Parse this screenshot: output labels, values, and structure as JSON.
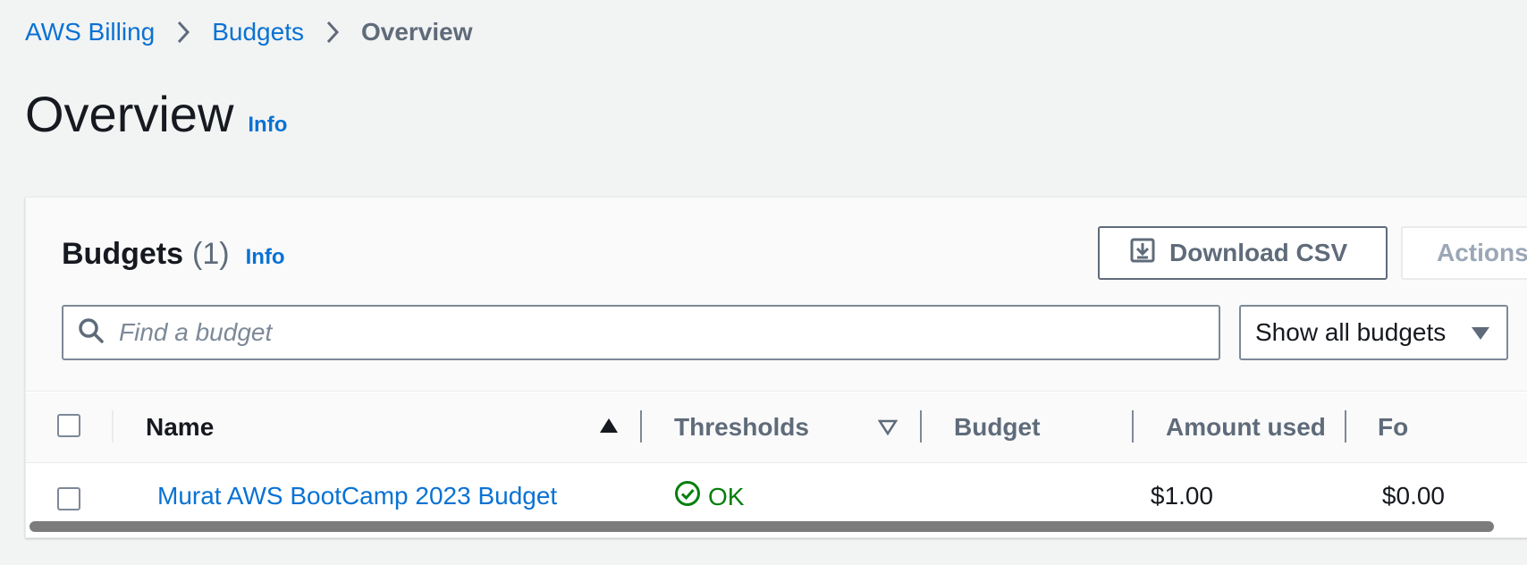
{
  "breadcrumb": {
    "items": [
      "AWS Billing",
      "Budgets"
    ],
    "current": "Overview"
  },
  "page": {
    "title": "Overview",
    "info": "Info"
  },
  "budgets_panel": {
    "title": "Budgets",
    "count": "(1)",
    "info": "Info",
    "download_csv": "Download CSV",
    "actions": "Actions",
    "search_placeholder": "Find a budget",
    "filter_selected": "Show all budgets"
  },
  "table": {
    "columns": [
      "Name",
      "Thresholds",
      "Budget",
      "Amount used",
      "Fo"
    ],
    "rows": [
      {
        "name": "Murat AWS BootCamp 2023 Budget",
        "thresholds": "OK",
        "budget": "$1.00",
        "amount_used": "$0.00"
      }
    ]
  },
  "colors": {
    "link": "#0972d3",
    "ok": "#037f0c",
    "background": "#f2f3f3"
  },
  "icons": [
    "chevron-right-icon",
    "download-icon",
    "search-icon",
    "caret-down-icon",
    "sort-ascending-icon",
    "sort-descending-icon",
    "check-circle-icon"
  ]
}
